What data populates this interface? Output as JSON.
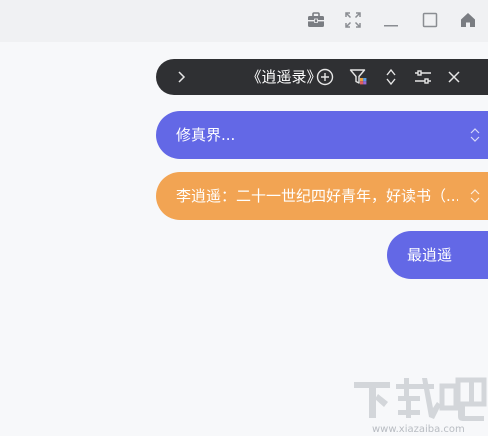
{
  "window_controls": {
    "icons": [
      "toolbox-icon",
      "fullscreen-icon",
      "minimize-icon",
      "maximize-icon",
      "home-icon"
    ]
  },
  "toolbar": {
    "title": "《逍遥录》",
    "icons": [
      "chevron-right-icon",
      "add-circle-icon",
      "filter-icon",
      "sort-updown-icon",
      "sliders-icon",
      "close-icon"
    ]
  },
  "world_select": {
    "value": "修真界..."
  },
  "character_select": {
    "value": "李逍遥：二十一世纪四好青年，好读书（..."
  },
  "action_button": {
    "label": "最逍遥"
  },
  "watermark": {
    "text": "下载吧",
    "url": "www.xiazaiba.com"
  },
  "colors": {
    "toolbar_bg": "#2f3033",
    "blue": "#6368e6",
    "orange": "#f2a453",
    "topbar_bg": "#f0f1f3",
    "page_bg": "#f7f8fa"
  }
}
